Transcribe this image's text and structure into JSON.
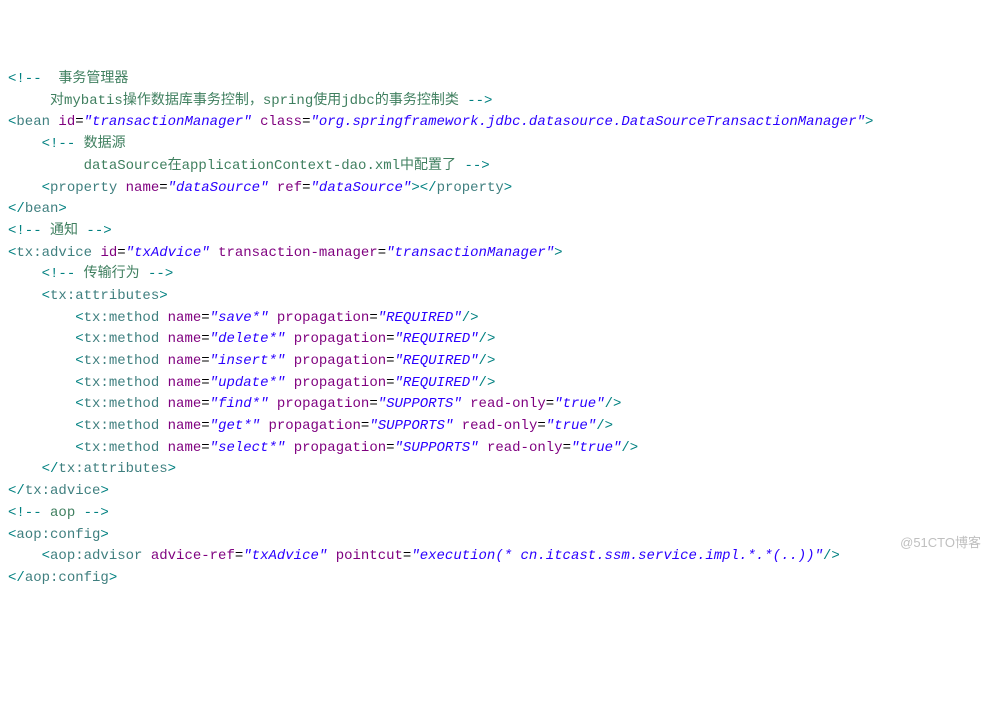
{
  "watermark": "@51CTO博客",
  "lines": [
    [
      {
        "c": "pn",
        "t": "<!--"
      },
      {
        "c": "cm",
        "t": "  事务管理器"
      }
    ],
    [
      {
        "c": "cm",
        "t": "     对mybatis操作数据库事务控制，spring使用jdbc的事务控制类 "
      },
      {
        "c": "pn",
        "t": "-->"
      }
    ],
    [
      {
        "c": "pn",
        "t": "<"
      },
      {
        "c": "tg",
        "t": "bean"
      },
      {
        "c": "",
        "t": " "
      },
      {
        "c": "an",
        "t": "id"
      },
      {
        "c": "",
        "t": "="
      },
      {
        "c": "av",
        "t": "\"transactionManager\""
      },
      {
        "c": "",
        "t": " "
      },
      {
        "c": "an",
        "t": "class"
      },
      {
        "c": "",
        "t": "="
      },
      {
        "c": "av",
        "t": "\"org.springframework.jdbc.datasource.DataSourceTransactionManager\""
      },
      {
        "c": "pn",
        "t": ">"
      }
    ],
    [
      {
        "c": "",
        "t": "    "
      },
      {
        "c": "pn",
        "t": "<!--"
      },
      {
        "c": "cm",
        "t": " 数据源"
      }
    ],
    [
      {
        "c": "cm",
        "t": "         dataSource在applicationContext-dao.xml中配置了 "
      },
      {
        "c": "pn",
        "t": "-->"
      }
    ],
    [
      {
        "c": "",
        "t": "    "
      },
      {
        "c": "pn",
        "t": "<"
      },
      {
        "c": "tg",
        "t": "property"
      },
      {
        "c": "",
        "t": " "
      },
      {
        "c": "an",
        "t": "name"
      },
      {
        "c": "",
        "t": "="
      },
      {
        "c": "av",
        "t": "\"dataSource\""
      },
      {
        "c": "",
        "t": " "
      },
      {
        "c": "an",
        "t": "ref"
      },
      {
        "c": "",
        "t": "="
      },
      {
        "c": "av",
        "t": "\"dataSource\""
      },
      {
        "c": "pn",
        "t": "></"
      },
      {
        "c": "tg",
        "t": "property"
      },
      {
        "c": "pn",
        "t": ">"
      }
    ],
    [
      {
        "c": "pn",
        "t": "</"
      },
      {
        "c": "tg",
        "t": "bean"
      },
      {
        "c": "pn",
        "t": ">"
      }
    ],
    [
      {
        "c": "pn",
        "t": "<!--"
      },
      {
        "c": "cm",
        "t": " 通知 "
      },
      {
        "c": "pn",
        "t": "-->"
      }
    ],
    [
      {
        "c": "pn",
        "t": "<"
      },
      {
        "c": "tg",
        "t": "tx:advice"
      },
      {
        "c": "",
        "t": " "
      },
      {
        "c": "an",
        "t": "id"
      },
      {
        "c": "",
        "t": "="
      },
      {
        "c": "av",
        "t": "\"txAdvice\""
      },
      {
        "c": "",
        "t": " "
      },
      {
        "c": "an",
        "t": "transaction-manager"
      },
      {
        "c": "",
        "t": "="
      },
      {
        "c": "av",
        "t": "\"transactionManager\""
      },
      {
        "c": "pn",
        "t": ">"
      }
    ],
    [
      {
        "c": "",
        "t": "    "
      },
      {
        "c": "pn",
        "t": "<!--"
      },
      {
        "c": "cm",
        "t": " 传输行为 "
      },
      {
        "c": "pn",
        "t": "-->"
      }
    ],
    [
      {
        "c": "",
        "t": "    "
      },
      {
        "c": "pn",
        "t": "<"
      },
      {
        "c": "tg",
        "t": "tx:attributes"
      },
      {
        "c": "pn",
        "t": ">"
      }
    ],
    [
      {
        "c": "",
        "t": "        "
      },
      {
        "c": "pn",
        "t": "<"
      },
      {
        "c": "tg",
        "t": "tx:method"
      },
      {
        "c": "",
        "t": " "
      },
      {
        "c": "an",
        "t": "name"
      },
      {
        "c": "",
        "t": "="
      },
      {
        "c": "av",
        "t": "\"save*\""
      },
      {
        "c": "",
        "t": " "
      },
      {
        "c": "an",
        "t": "propagation"
      },
      {
        "c": "",
        "t": "="
      },
      {
        "c": "av",
        "t": "\"REQUIRED\""
      },
      {
        "c": "pn",
        "t": "/>"
      }
    ],
    [
      {
        "c": "",
        "t": "        "
      },
      {
        "c": "pn",
        "t": "<"
      },
      {
        "c": "tg",
        "t": "tx:method"
      },
      {
        "c": "",
        "t": " "
      },
      {
        "c": "an",
        "t": "name"
      },
      {
        "c": "",
        "t": "="
      },
      {
        "c": "av",
        "t": "\"delete*\""
      },
      {
        "c": "",
        "t": " "
      },
      {
        "c": "an",
        "t": "propagation"
      },
      {
        "c": "",
        "t": "="
      },
      {
        "c": "av",
        "t": "\"REQUIRED\""
      },
      {
        "c": "pn",
        "t": "/>"
      }
    ],
    [
      {
        "c": "",
        "t": "        "
      },
      {
        "c": "pn",
        "t": "<"
      },
      {
        "c": "tg",
        "t": "tx:method"
      },
      {
        "c": "",
        "t": " "
      },
      {
        "c": "an",
        "t": "name"
      },
      {
        "c": "",
        "t": "="
      },
      {
        "c": "av",
        "t": "\"insert*\""
      },
      {
        "c": "",
        "t": " "
      },
      {
        "c": "an",
        "t": "propagation"
      },
      {
        "c": "",
        "t": "="
      },
      {
        "c": "av",
        "t": "\"REQUIRED\""
      },
      {
        "c": "pn",
        "t": "/>"
      }
    ],
    [
      {
        "c": "",
        "t": "        "
      },
      {
        "c": "pn",
        "t": "<"
      },
      {
        "c": "tg",
        "t": "tx:method"
      },
      {
        "c": "",
        "t": " "
      },
      {
        "c": "an",
        "t": "name"
      },
      {
        "c": "",
        "t": "="
      },
      {
        "c": "av",
        "t": "\"update*\""
      },
      {
        "c": "",
        "t": " "
      },
      {
        "c": "an",
        "t": "propagation"
      },
      {
        "c": "",
        "t": "="
      },
      {
        "c": "av",
        "t": "\"REQUIRED\""
      },
      {
        "c": "pn",
        "t": "/>"
      }
    ],
    [
      {
        "c": "",
        "t": "        "
      },
      {
        "c": "pn",
        "t": "<"
      },
      {
        "c": "tg",
        "t": "tx:method"
      },
      {
        "c": "",
        "t": " "
      },
      {
        "c": "an",
        "t": "name"
      },
      {
        "c": "",
        "t": "="
      },
      {
        "c": "av",
        "t": "\"find*\""
      },
      {
        "c": "",
        "t": " "
      },
      {
        "c": "an",
        "t": "propagation"
      },
      {
        "c": "",
        "t": "="
      },
      {
        "c": "av",
        "t": "\"SUPPORTS\""
      },
      {
        "c": "",
        "t": " "
      },
      {
        "c": "an",
        "t": "read-only"
      },
      {
        "c": "",
        "t": "="
      },
      {
        "c": "av",
        "t": "\"true\""
      },
      {
        "c": "pn",
        "t": "/>"
      }
    ],
    [
      {
        "c": "",
        "t": "        "
      },
      {
        "c": "pn",
        "t": "<"
      },
      {
        "c": "tg",
        "t": "tx:method"
      },
      {
        "c": "",
        "t": " "
      },
      {
        "c": "an",
        "t": "name"
      },
      {
        "c": "",
        "t": "="
      },
      {
        "c": "av",
        "t": "\"get*\""
      },
      {
        "c": "",
        "t": " "
      },
      {
        "c": "an",
        "t": "propagation"
      },
      {
        "c": "",
        "t": "="
      },
      {
        "c": "av",
        "t": "\"SUPPORTS\""
      },
      {
        "c": "",
        "t": " "
      },
      {
        "c": "an",
        "t": "read-only"
      },
      {
        "c": "",
        "t": "="
      },
      {
        "c": "av",
        "t": "\"true\""
      },
      {
        "c": "pn",
        "t": "/>"
      }
    ],
    [
      {
        "c": "",
        "t": "        "
      },
      {
        "c": "pn",
        "t": "<"
      },
      {
        "c": "tg",
        "t": "tx:method"
      },
      {
        "c": "",
        "t": " "
      },
      {
        "c": "an",
        "t": "name"
      },
      {
        "c": "",
        "t": "="
      },
      {
        "c": "av",
        "t": "\"select*\""
      },
      {
        "c": "",
        "t": " "
      },
      {
        "c": "an",
        "t": "propagation"
      },
      {
        "c": "",
        "t": "="
      },
      {
        "c": "av",
        "t": "\"SUPPORTS\""
      },
      {
        "c": "",
        "t": " "
      },
      {
        "c": "an",
        "t": "read-only"
      },
      {
        "c": "",
        "t": "="
      },
      {
        "c": "av",
        "t": "\"true\""
      },
      {
        "c": "pn",
        "t": "/>"
      }
    ],
    [
      {
        "c": "",
        "t": "    "
      },
      {
        "c": "pn",
        "t": "</"
      },
      {
        "c": "tg",
        "t": "tx:attributes"
      },
      {
        "c": "pn",
        "t": ">"
      }
    ],
    [
      {
        "c": "",
        "t": ""
      }
    ],
    [
      {
        "c": "pn",
        "t": "</"
      },
      {
        "c": "tg",
        "t": "tx:advice"
      },
      {
        "c": "pn",
        "t": ">"
      }
    ],
    [
      {
        "c": "pn",
        "t": "<!--"
      },
      {
        "c": "cm",
        "t": " aop "
      },
      {
        "c": "pn",
        "t": "-->"
      }
    ],
    [
      {
        "c": "pn",
        "t": "<"
      },
      {
        "c": "tg",
        "t": "aop:config"
      },
      {
        "c": "pn",
        "t": ">"
      }
    ],
    [
      {
        "c": "",
        "t": "    "
      },
      {
        "c": "pn",
        "t": "<"
      },
      {
        "c": "tg",
        "t": "aop:advisor"
      },
      {
        "c": "",
        "t": " "
      },
      {
        "c": "an",
        "t": "advice-ref"
      },
      {
        "c": "",
        "t": "="
      },
      {
        "c": "av",
        "t": "\"txAdvice\""
      },
      {
        "c": "",
        "t": " "
      },
      {
        "c": "an",
        "t": "pointcut"
      },
      {
        "c": "",
        "t": "="
      },
      {
        "c": "av",
        "t": "\"execution(* cn.itcast.ssm.service.impl.*.*(..))\""
      },
      {
        "c": "pn",
        "t": "/>"
      }
    ],
    [
      {
        "c": "pn",
        "t": "</"
      },
      {
        "c": "tg",
        "t": "aop:config"
      },
      {
        "c": "pn",
        "t": ">"
      }
    ]
  ]
}
